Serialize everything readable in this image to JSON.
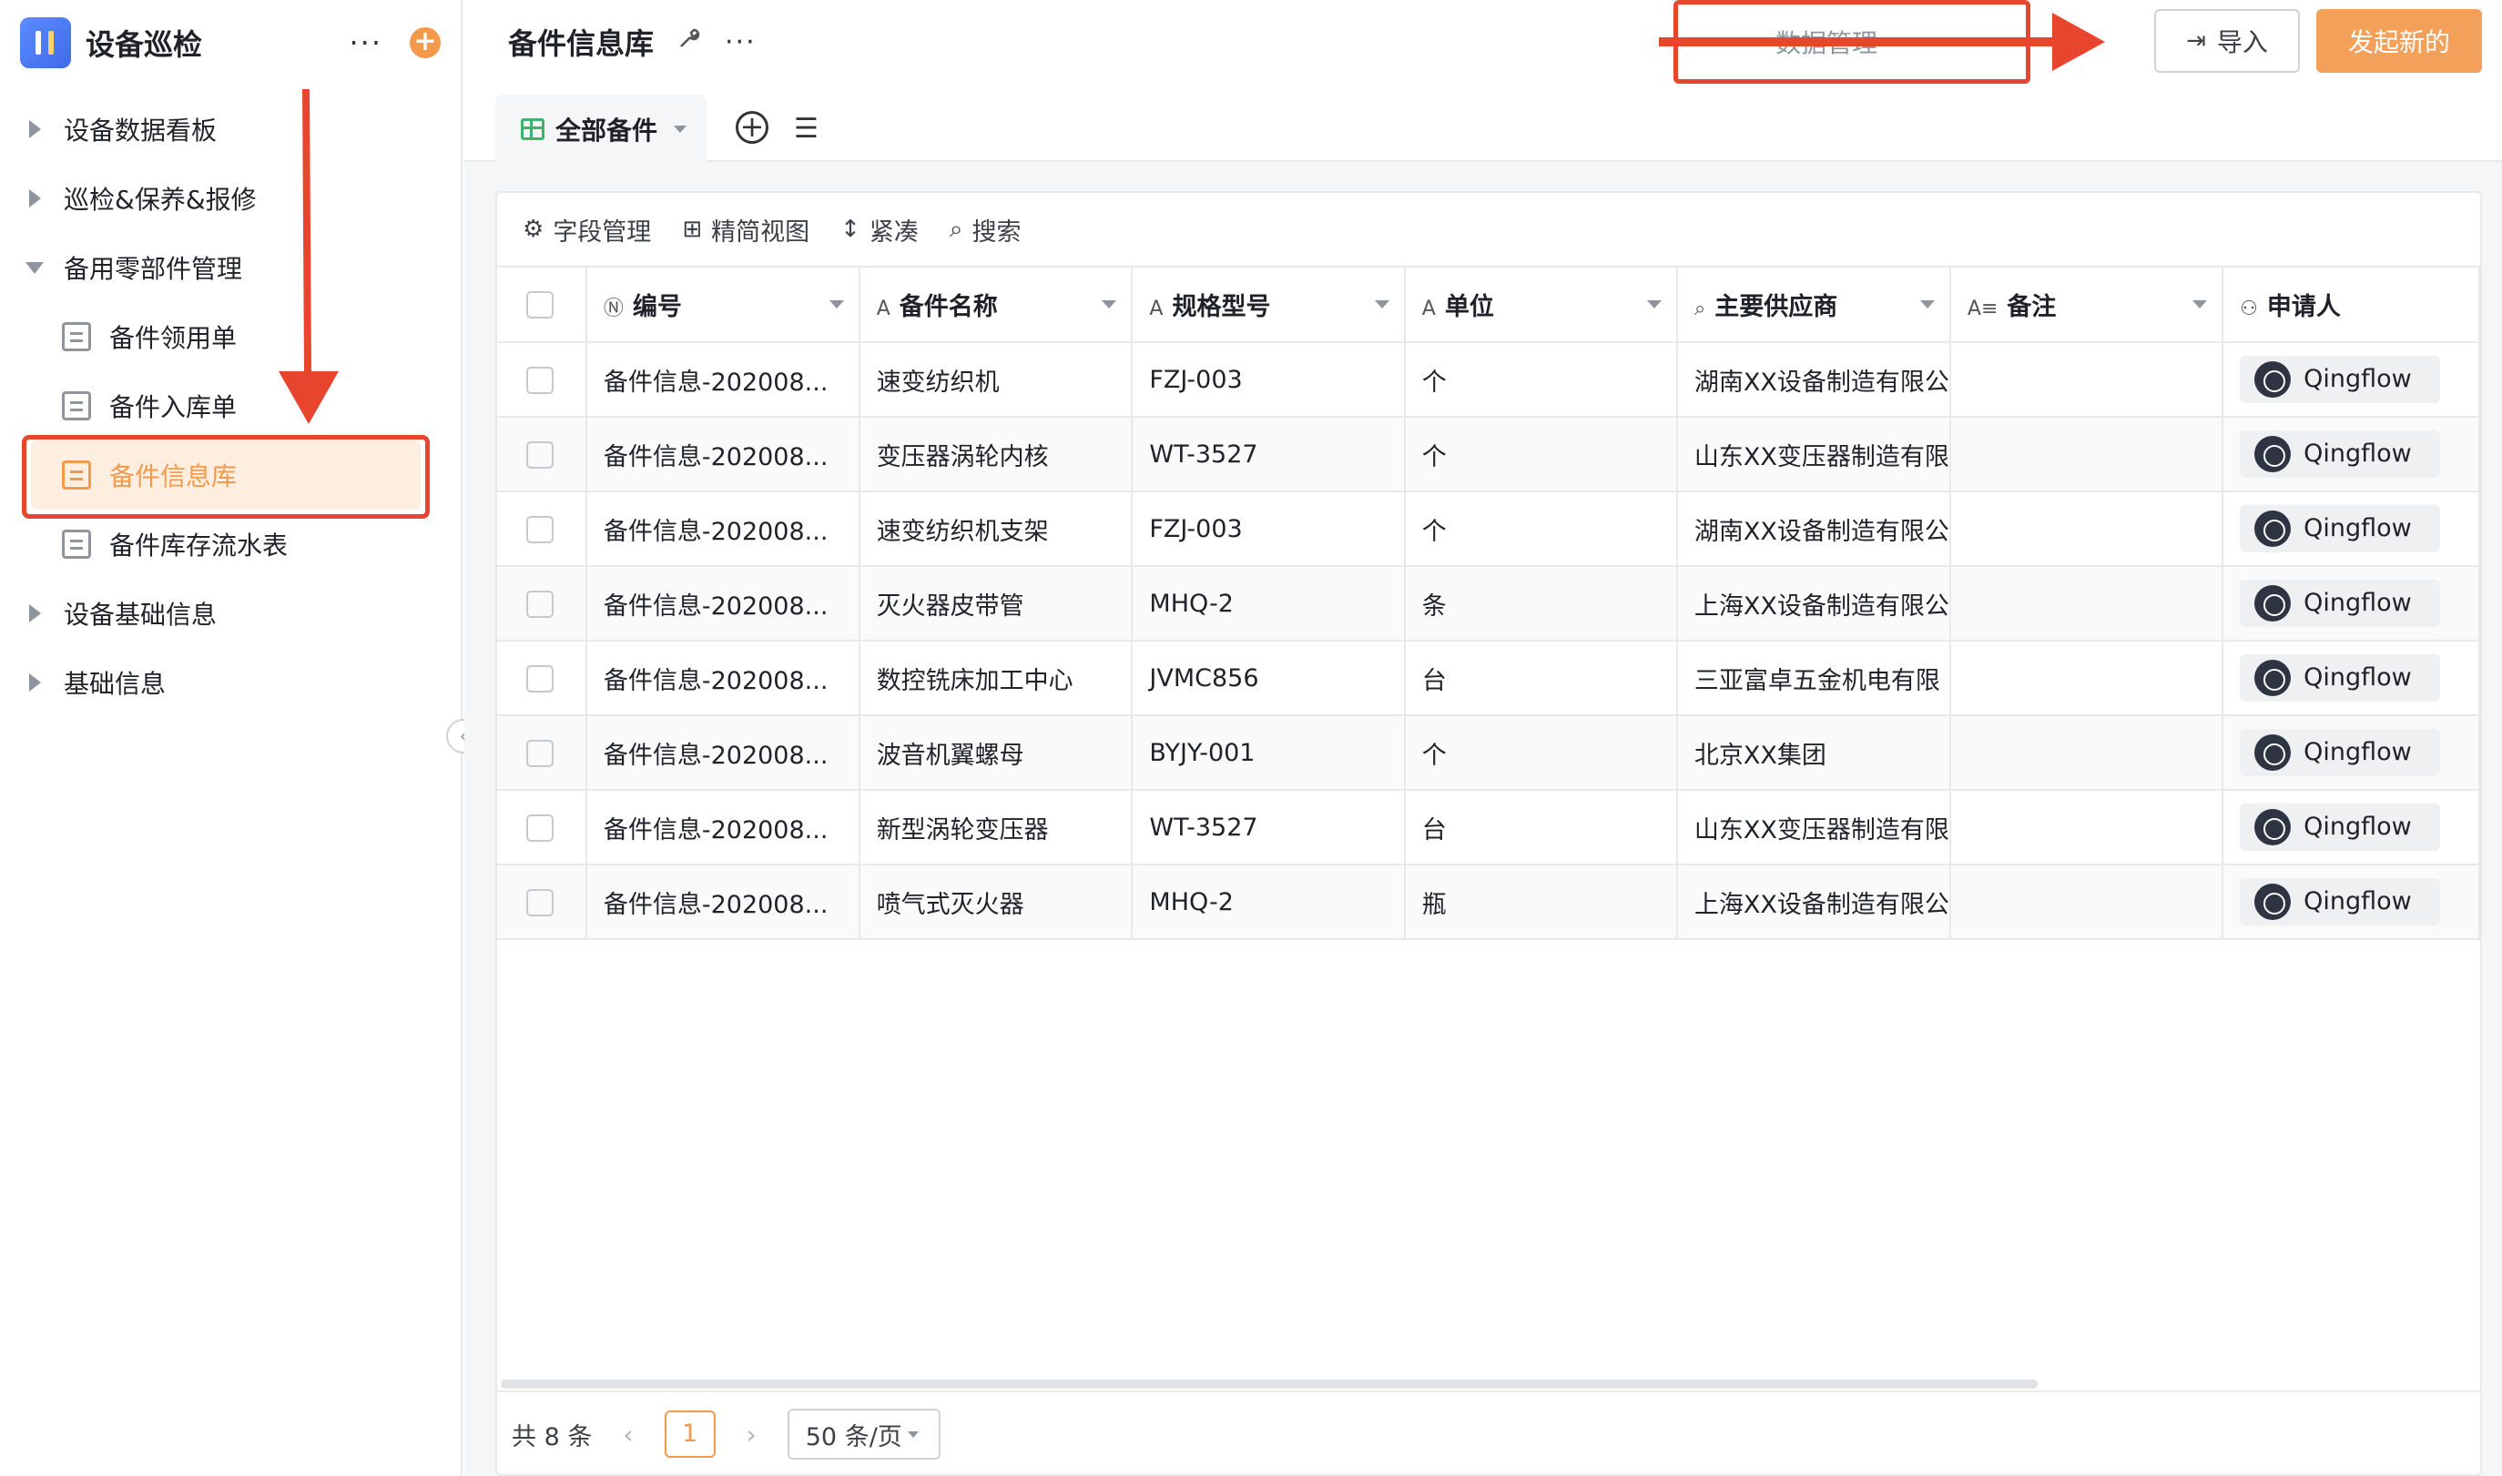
{
  "app": {
    "title": "设备巡检",
    "more": "···",
    "add": "+"
  },
  "sidebar": {
    "items": [
      {
        "label": "设备数据看板",
        "type": "group",
        "expanded": false
      },
      {
        "label": "巡检&保养&报修",
        "type": "group",
        "expanded": false
      },
      {
        "label": "备用零部件管理",
        "type": "group",
        "expanded": true
      },
      {
        "label": "备件领用单",
        "type": "form"
      },
      {
        "label": "备件入库单",
        "type": "form"
      },
      {
        "label": "备件信息库",
        "type": "form",
        "active": true
      },
      {
        "label": "备件库存流水表",
        "type": "form"
      },
      {
        "label": "设备基础信息",
        "type": "group",
        "expanded": false
      },
      {
        "label": "基础信息",
        "type": "group",
        "expanded": false
      }
    ]
  },
  "header": {
    "page_title": "备件信息库",
    "data_manage": "数据管理",
    "import_label": "导入",
    "new_label": "发起新的"
  },
  "tabs": {
    "active_label": "全部备件"
  },
  "toolbar": {
    "fields": "字段管理",
    "simple_view": "精简视图",
    "compact": "紧凑",
    "search": "搜索"
  },
  "table": {
    "columns": [
      "编号",
      "备件名称",
      "规格型号",
      "单位",
      "主要供应商",
      "备注",
      "申请人"
    ],
    "column_icons": [
      "N",
      "A",
      "A",
      "A",
      "Q",
      "A≡",
      "person"
    ],
    "rows": [
      [
        "备件信息-202008...",
        "速变纺织机",
        "FZJ-003",
        "个",
        "湖南XX设备制造有限公",
        "",
        "Qingflow"
      ],
      [
        "备件信息-202008...",
        "变压器涡轮内核",
        "WT-3527",
        "个",
        "山东XX变压器制造有限",
        "",
        "Qingflow"
      ],
      [
        "备件信息-202008...",
        "速变纺织机支架",
        "FZJ-003",
        "个",
        "湖南XX设备制造有限公",
        "",
        "Qingflow"
      ],
      [
        "备件信息-202008...",
        "灭火器皮带管",
        "MHQ-2",
        "条",
        "上海XX设备制造有限公",
        "",
        "Qingflow"
      ],
      [
        "备件信息-202008...",
        "数控铣床加工中心",
        "JVMC856",
        "台",
        "三亚富卓五金机电有限",
        "",
        "Qingflow"
      ],
      [
        "备件信息-202008...",
        "波音机翼螺母",
        "BYJY-001",
        "个",
        "北京XX集团",
        "",
        "Qingflow"
      ],
      [
        "备件信息-202008...",
        "新型涡轮变压器",
        "WT-3527",
        "台",
        "山东XX变压器制造有限",
        "",
        "Qingflow"
      ],
      [
        "备件信息-202008...",
        "喷气式灭火器",
        "MHQ-2",
        "瓶",
        "上海XX设备制造有限公",
        "",
        "Qingflow"
      ]
    ]
  },
  "footer": {
    "total": "共 8 条",
    "page": "1",
    "page_size": "50 条/页"
  },
  "colors": {
    "accent": "#f2994a",
    "annotation": "#e8452f"
  }
}
